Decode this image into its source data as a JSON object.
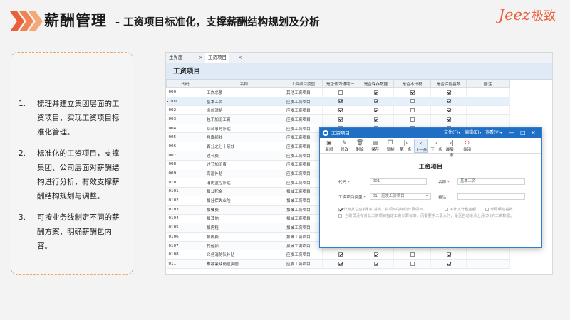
{
  "header": {
    "title": "薪酬管理",
    "subtitle": "- 工资项目标准化，支撑薪酬结构规划及分析",
    "brand_latin": "Jeez",
    "brand_cn": "极致",
    "accent_color": "#e9603a"
  },
  "notes": [
    {
      "num": "1.",
      "text": "梳理并建立集团层面的工资项目，实现工资项目标准化管理。"
    },
    {
      "num": "2.",
      "text": "标准化的工资项目，支撑集团、公司层面对薪酬结构进行分析，有效支撑薪酬结构规划与调整。"
    },
    {
      "num": "3.",
      "text": "可按业务线制定不同的薪酬方案，明确薪酬包内容。"
    }
  ],
  "app": {
    "tabs": [
      {
        "label": "主界面",
        "close": "×"
      },
      {
        "label": "工资项目",
        "close": "×"
      }
    ],
    "page_title": "工资项目",
    "columns": [
      "代码",
      "名称",
      "工资项目类型",
      "是否作为辅助计",
      "是否保存数据",
      "是否不计税",
      "是否保险基数",
      "备注"
    ],
    "rows": [
      {
        "code": "000",
        "name": "工作总额",
        "type": "其他工资项目",
        "c1": false,
        "c2": true,
        "c3": true,
        "c4": true
      },
      {
        "code": "001",
        "name": "基本工资",
        "type": "应发工资项目",
        "c1": true,
        "c2": true,
        "c3": false,
        "c4": true,
        "selected": true
      },
      {
        "code": "002",
        "name": "岗位津贴",
        "type": "应发工资项目",
        "c1": true,
        "c2": true,
        "c3": false,
        "c4": true
      },
      {
        "code": "003",
        "name": "包干加班工资",
        "type": "应发工资项目",
        "c1": true,
        "c2": true,
        "c3": false,
        "c4": true
      },
      {
        "code": "004",
        "name": "综合事务补贴",
        "type": "应发工资项目",
        "c1": true,
        "c2": true,
        "c3": false,
        "c4": true
      },
      {
        "code": "005",
        "name": "月度绩效",
        "type": "应发工资项目",
        "c1": true,
        "c2": true,
        "c3": false,
        "c4": true
      },
      {
        "code": "006",
        "name": "百分之七十绩效",
        "type": "应发工资项目",
        "c1": true,
        "c2": true,
        "c3": false,
        "c4": true
      },
      {
        "code": "007",
        "name": "过节费",
        "type": "应发工资项目",
        "c1": true,
        "c2": true,
        "c3": false,
        "c4": true
      },
      {
        "code": "008",
        "name": "过节加班费",
        "type": "应发工资项目",
        "c1": true,
        "c2": true,
        "c3": false,
        "c4": true
      },
      {
        "code": "009",
        "name": "高温补贴",
        "type": "应发工资项目",
        "c1": true,
        "c2": true,
        "c3": false,
        "c4": true
      },
      {
        "code": "010",
        "name": "消防监控补贴",
        "type": "应发工资项目",
        "c1": true,
        "c2": true,
        "c3": false,
        "c4": true
      },
      {
        "code": "0101",
        "name": "扣公积金",
        "type": "扣减工资项目",
        "c1": true,
        "c2": true,
        "c3": false,
        "c4": true
      },
      {
        "code": "0102",
        "name": "扣社保失业险",
        "type": "扣减工资项目",
        "c1": true,
        "c2": true,
        "c3": false,
        "c4": true
      },
      {
        "code": "0103",
        "name": "扣餐费",
        "type": "扣减工资项目",
        "c1": true,
        "c2": true,
        "c3": false,
        "c4": true
      },
      {
        "code": "0104",
        "name": "扣其他",
        "type": "扣减工资项目",
        "c1": true,
        "c2": true,
        "c3": false,
        "c4": true
      },
      {
        "code": "0105",
        "name": "扣房租",
        "type": "扣减工资项目",
        "c1": true,
        "c2": true,
        "c3": false,
        "c4": true
      },
      {
        "code": "0106",
        "name": "扣税费",
        "type": "扣减工资项目",
        "c1": true,
        "c2": true,
        "c3": false,
        "c4": true
      },
      {
        "code": "0107",
        "name": "其他扣",
        "type": "扣减工资项目",
        "c1": true,
        "c2": true,
        "c3": false,
        "c4": true
      },
      {
        "code": "0108",
        "name": "义务消防队补贴",
        "type": "应发工资项目",
        "c1": true,
        "c2": true,
        "c3": false,
        "c4": true
      },
      {
        "code": "011",
        "name": "推荐紧缺岗位奖励",
        "type": "应发工资项目",
        "c1": true,
        "c2": true,
        "c3": false,
        "c4": true
      }
    ]
  },
  "dialog": {
    "title": "工资项目",
    "menus": [
      "文件(F)▾",
      "编辑(E)▾",
      "查看(V)▾"
    ],
    "window_buttons": [
      "—",
      "□",
      "✕"
    ],
    "toolbar": [
      {
        "label": "新增",
        "glyph": "▣"
      },
      {
        "label": "修改",
        "glyph": "✎"
      },
      {
        "label": "删除",
        "glyph": "🗑"
      },
      {
        "label": "保存",
        "glyph": "▤"
      },
      {
        "label": "复制",
        "glyph": "❐"
      },
      {
        "label": "第一条",
        "glyph": "|‹"
      },
      {
        "label": "上一条",
        "glyph": "‹"
      },
      {
        "label": "下一条",
        "glyph": "›"
      },
      {
        "label": "最后一条",
        "glyph": "›|"
      },
      {
        "label": "关闭",
        "glyph": "⏻"
      }
    ],
    "form_title": "工资项目",
    "fields": {
      "code_label": "代码",
      "code_value": "001",
      "name_label": "名称",
      "name_value": "基本工资",
      "type_label": "工资项目类型",
      "type_value": "01 - 应发工资项目",
      "remark_label": "备注",
      "remark_value": "",
      "required_mark": "*"
    },
    "checks": {
      "aux": "作为其它应发和扣减类工资项目的辅助计算项目",
      "no_tax": "不计入计税金额",
      "insurance": "计算保险基数",
      "note": "当职员没有对此工资项目指定工资计算标准，而需要手工录入时，是否自动继承上月(次)的工资数据。"
    }
  }
}
